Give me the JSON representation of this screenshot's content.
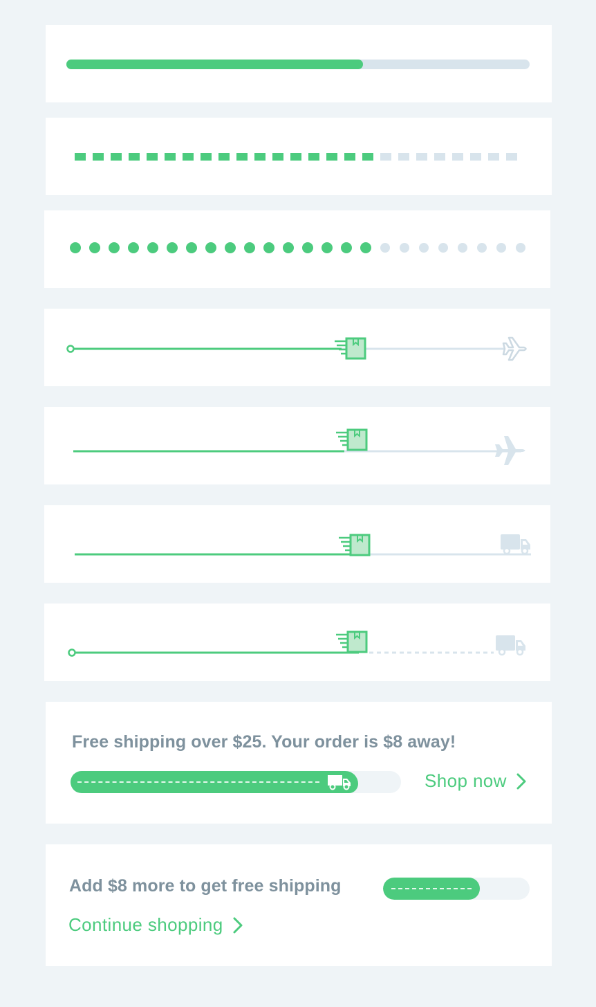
{
  "colors": {
    "background": "#eff4f7",
    "card": "#ffffff",
    "accent_green": "#4ccb7e",
    "light_green": "#bfe9cd",
    "track": "#d8e4ec",
    "text_gray": "#7e919d"
  },
  "bars": [
    {
      "style": "solid",
      "progress": 0.64
    },
    {
      "style": "dashed-squares",
      "progress": 0.6
    },
    {
      "style": "dots",
      "progress": 0.67
    },
    {
      "style": "line-box-plane-outline",
      "start_marker": true,
      "end_icon": "airplane-icon",
      "progress": 0.66
    },
    {
      "style": "line-box-plane-solid",
      "start_marker": false,
      "end_icon": "airplane-icon",
      "progress": 0.66
    },
    {
      "style": "line-box-truck",
      "start_marker": false,
      "end_icon": "truck-icon",
      "progress": 0.66
    },
    {
      "style": "line-box-truck-dashed",
      "start_marker": true,
      "end_icon": "truck-icon",
      "progress": 0.66
    }
  ],
  "free_shipping_banner": {
    "message": "Free shipping over $25. Your order is $8 away!",
    "link_label": "Shop now",
    "progress": 0.87,
    "icon": "truck-icon"
  },
  "add_more_banner": {
    "message": "Add $8 more to get free shipping",
    "link_label": "Continue shopping",
    "progress": 0.66
  }
}
